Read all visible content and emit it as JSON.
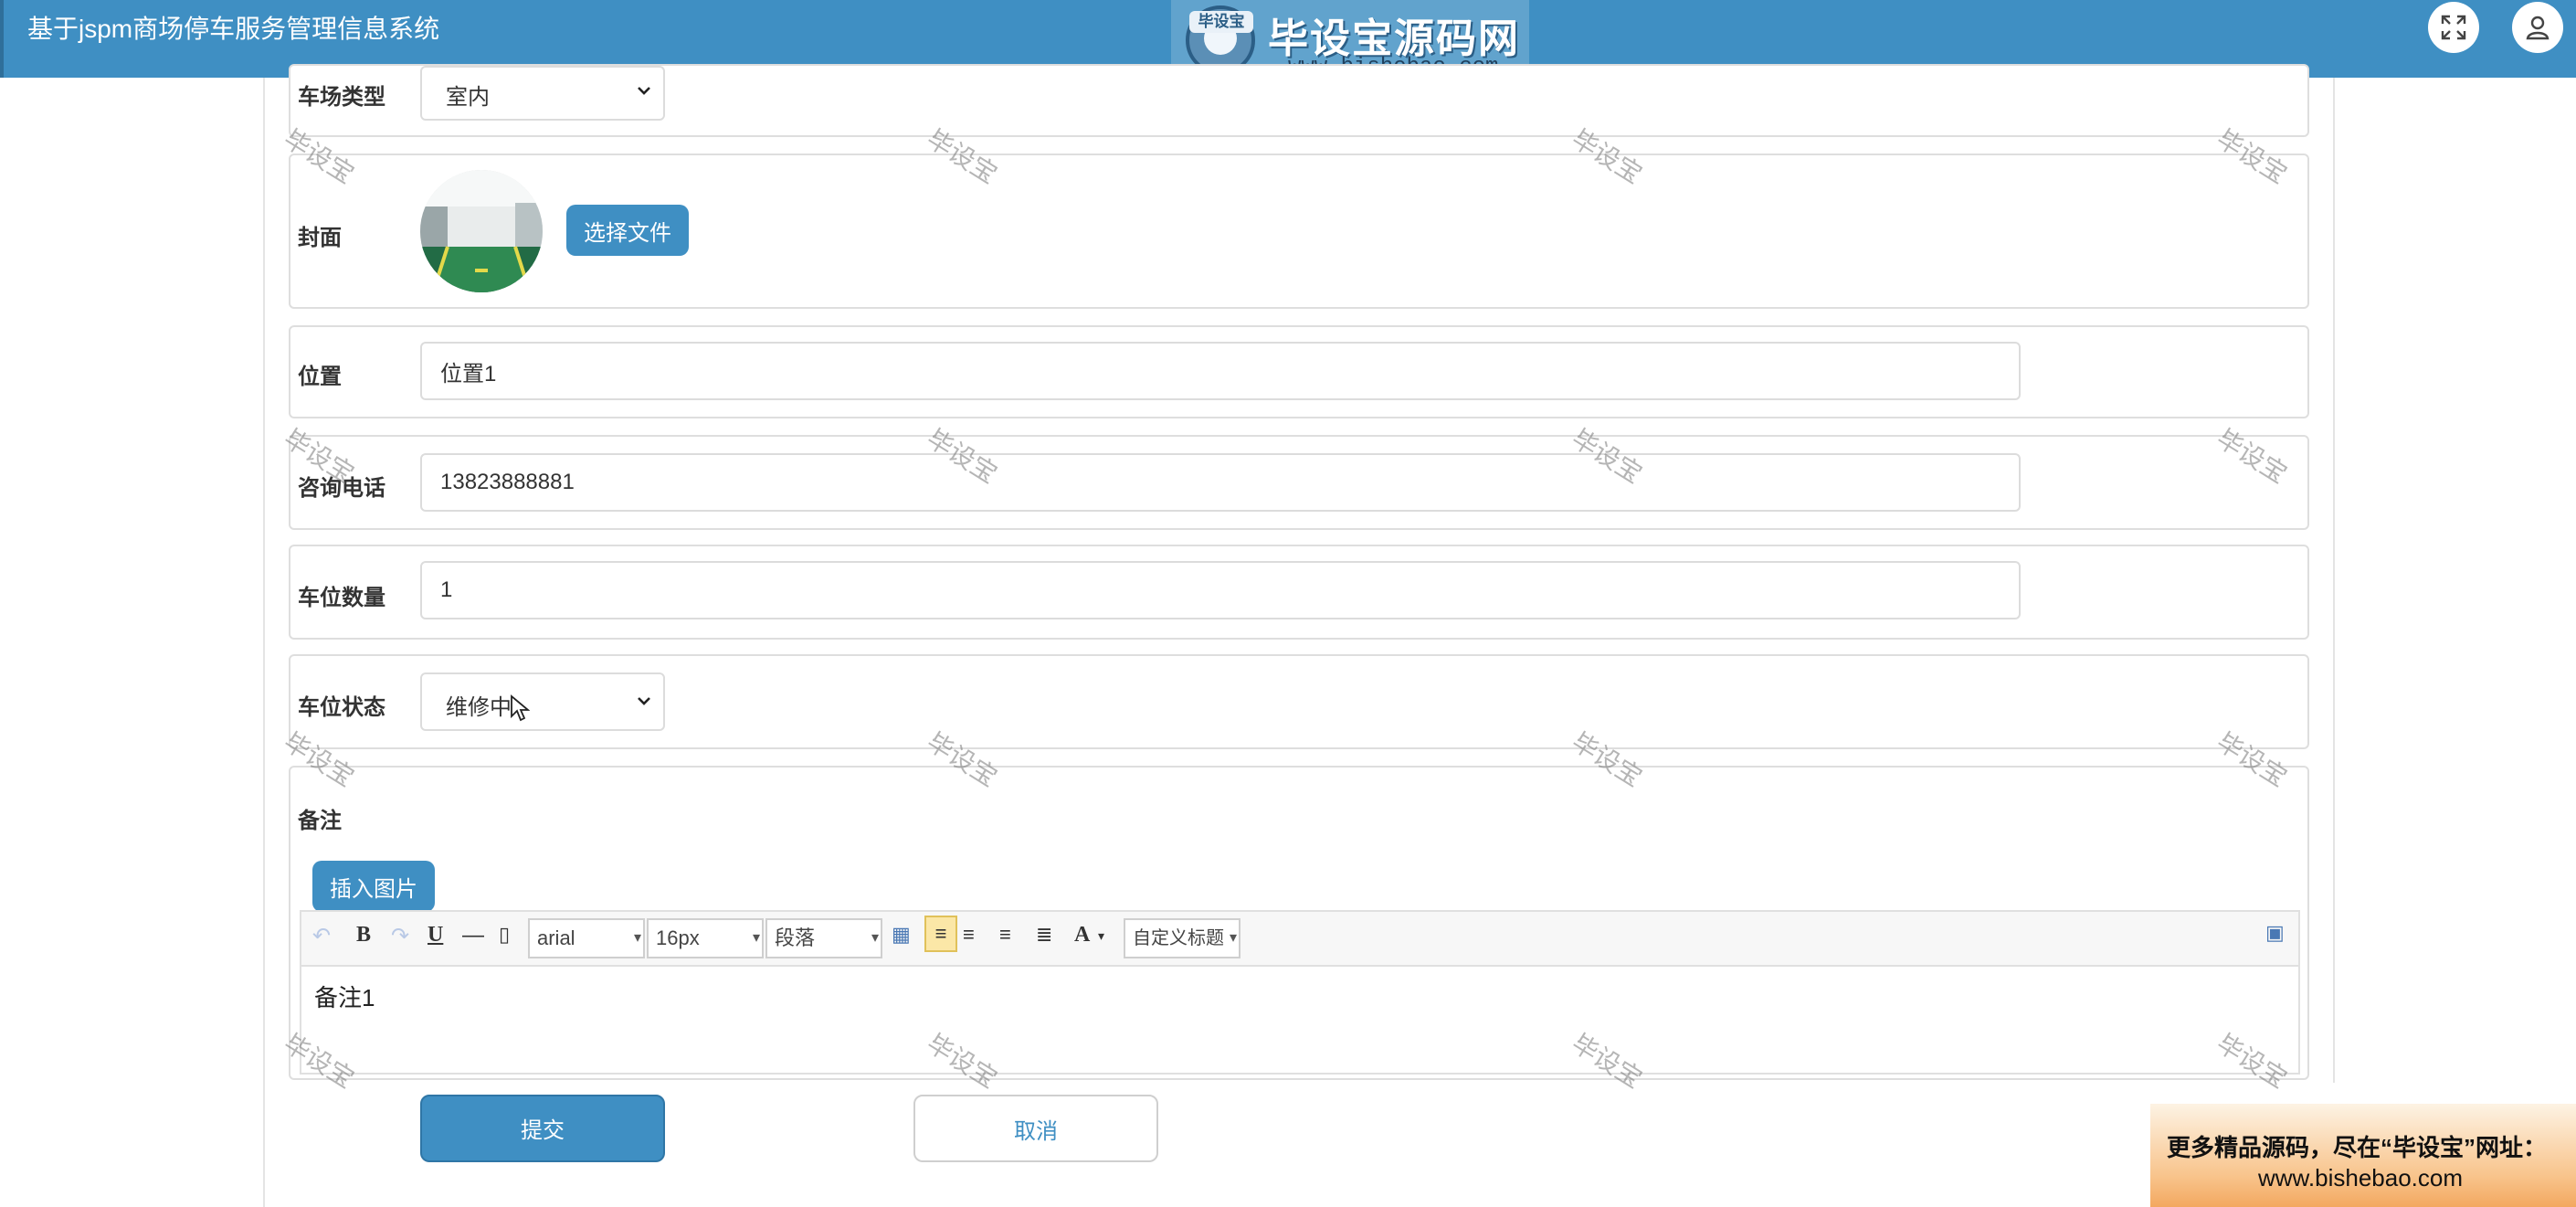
{
  "header": {
    "app_title": "基于jspm商场停车服务管理信息系统",
    "brand_badge": "毕设宝",
    "brand_name": "毕设宝源码网",
    "brand_url": "www.bishebao.com",
    "expand_icon": "expand-icon",
    "user_icon": "user-icon"
  },
  "form": {
    "lot_type": {
      "label": "车场类型",
      "value": "室内"
    },
    "cover": {
      "label": "封面",
      "button": "选择文件"
    },
    "location": {
      "label": "位置",
      "value": "位置1"
    },
    "phone": {
      "label": "咨询电话",
      "value": "13823888881"
    },
    "space_count": {
      "label": "车位数量",
      "value": "1"
    },
    "space_status": {
      "label": "车位状态",
      "value": "维修中"
    },
    "remark": {
      "label": "备注",
      "insert_image": "插入图片",
      "font_family": "arial",
      "font_size": "16px",
      "paragraph": "段落",
      "custom_title": "自定义标题",
      "content": "备注1"
    },
    "submit": "提交",
    "cancel": "取消"
  },
  "watermark": "毕设宝",
  "promo": {
    "line1": "更多精品源码，尽在“毕设宝”网址：",
    "line2": "www.bishebao.com"
  },
  "colors": {
    "header_bg": "#3f8fc3",
    "primary_button": "#3f8fc3",
    "border": "#dedede"
  }
}
